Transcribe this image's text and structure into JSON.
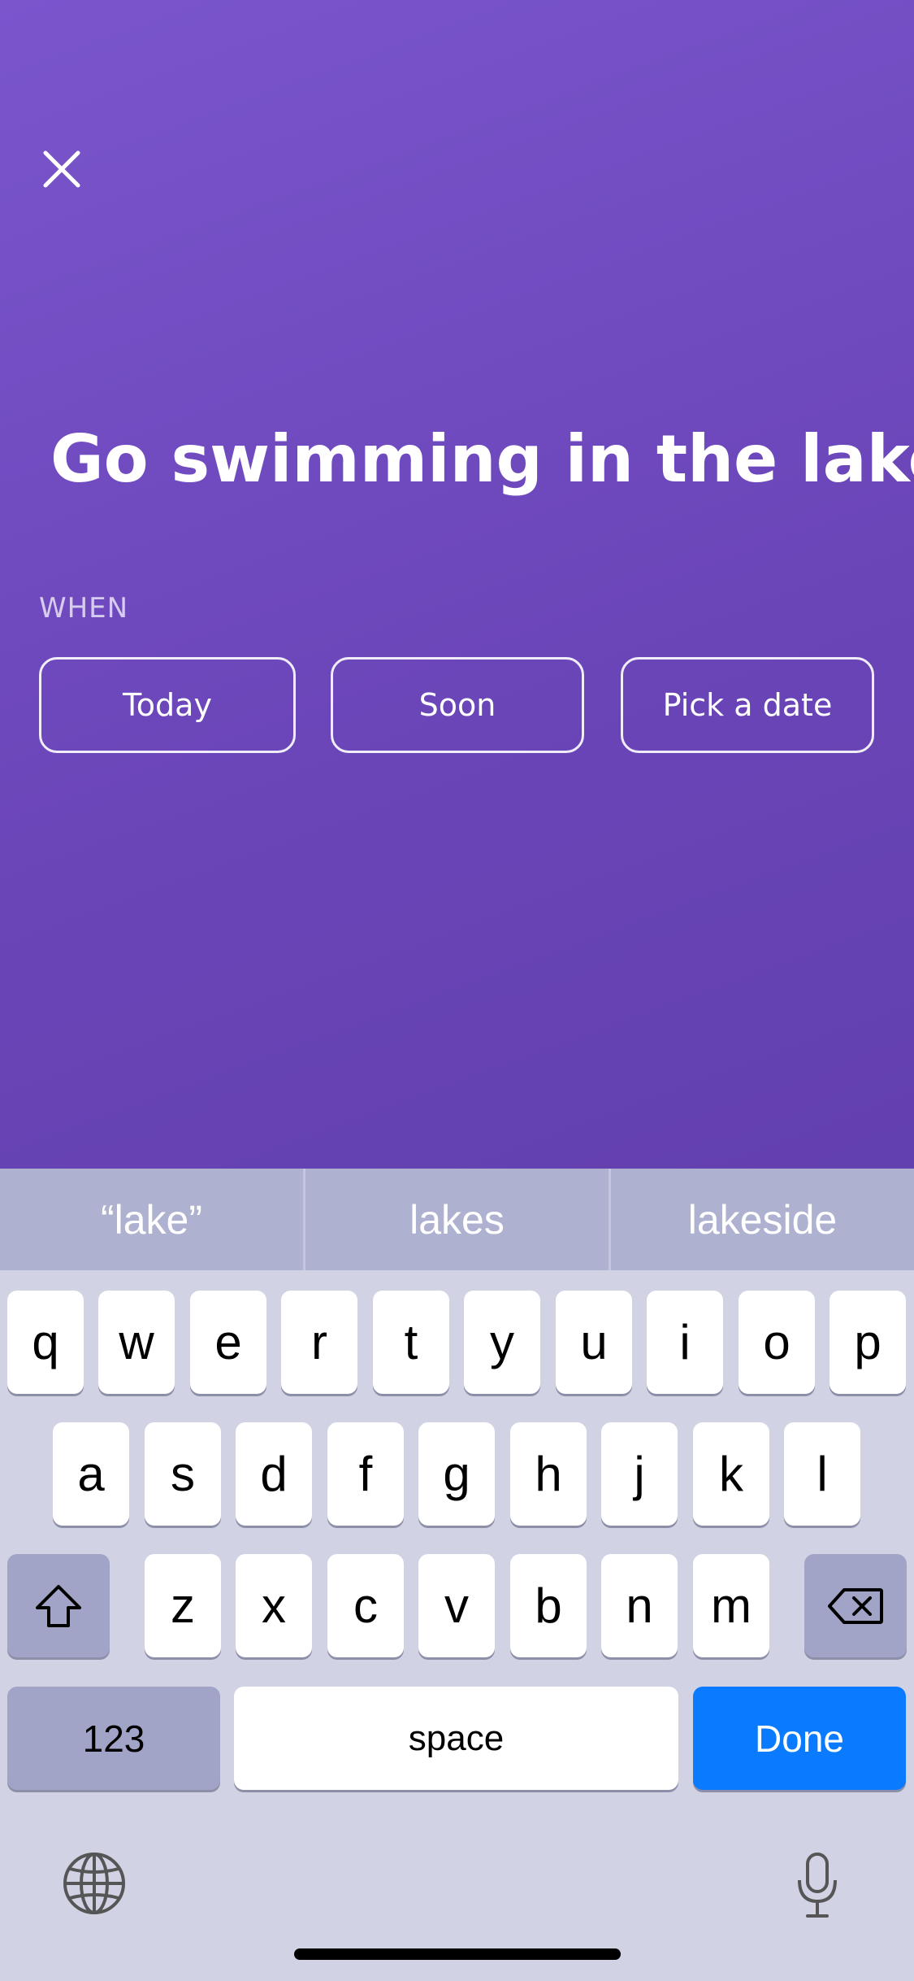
{
  "task": {
    "title": "Go swimming in the lake"
  },
  "when": {
    "label": "WHEN",
    "options": [
      "Today",
      "Soon",
      "Pick a date"
    ]
  },
  "keyboard": {
    "suggestions": [
      "“lake”",
      "lakes",
      "lakeside"
    ],
    "row1": [
      "q",
      "w",
      "e",
      "r",
      "t",
      "y",
      "u",
      "i",
      "o",
      "p"
    ],
    "row2": [
      "a",
      "s",
      "d",
      "f",
      "g",
      "h",
      "j",
      "k",
      "l"
    ],
    "row3": [
      "z",
      "x",
      "c",
      "v",
      "b",
      "n",
      "m"
    ],
    "numbers_label": "123",
    "space_label": "space",
    "done_label": "Done",
    "icons": {
      "shift": "shift-icon",
      "delete": "delete-icon",
      "globe": "globe-icon",
      "mic": "microphone-icon"
    }
  },
  "colors": {
    "accent": "#0a7aff",
    "background_top": "#7a55cc",
    "background_bottom": "#6240ad"
  }
}
